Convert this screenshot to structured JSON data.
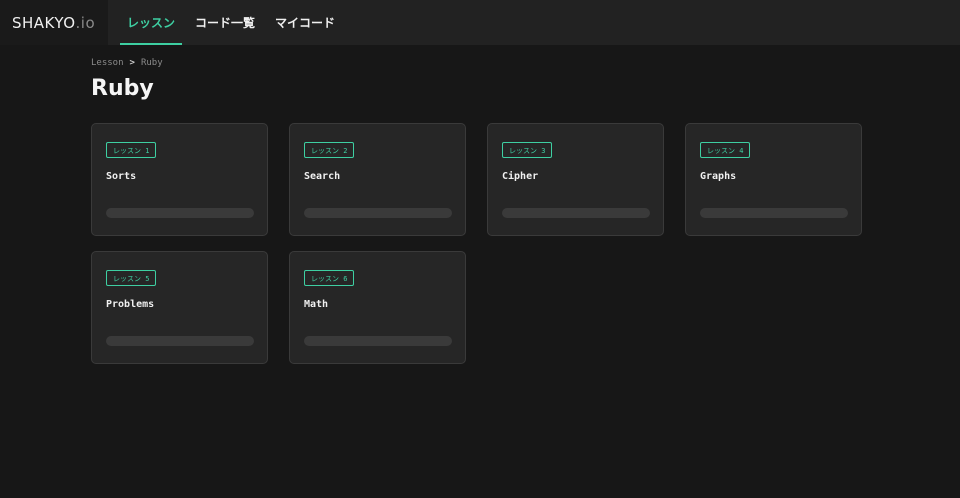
{
  "brand": {
    "name": "SHAKYO",
    "suffix": ".io"
  },
  "nav": {
    "items": [
      {
        "label": "レッスン",
        "active": true
      },
      {
        "label": "コード一覧",
        "active": false
      },
      {
        "label": "マイコード",
        "active": false
      }
    ]
  },
  "breadcrumb": {
    "root": "Lesson",
    "separator": ">",
    "current": "Ruby"
  },
  "page": {
    "title": "Ruby"
  },
  "lessons": [
    {
      "badge": "レッスン 1",
      "title": "Sorts",
      "progress": 0
    },
    {
      "badge": "レッスン 2",
      "title": "Search",
      "progress": 0
    },
    {
      "badge": "レッスン 3",
      "title": "Cipher",
      "progress": 0
    },
    {
      "badge": "レッスン 4",
      "title": "Graphs",
      "progress": 0
    },
    {
      "badge": "レッスン 5",
      "title": "Problems",
      "progress": 0
    },
    {
      "badge": "レッスン 6",
      "title": "Math",
      "progress": 0
    }
  ],
  "colors": {
    "accent": "#3ecfa2",
    "background": "#171717",
    "card": "#262626"
  }
}
